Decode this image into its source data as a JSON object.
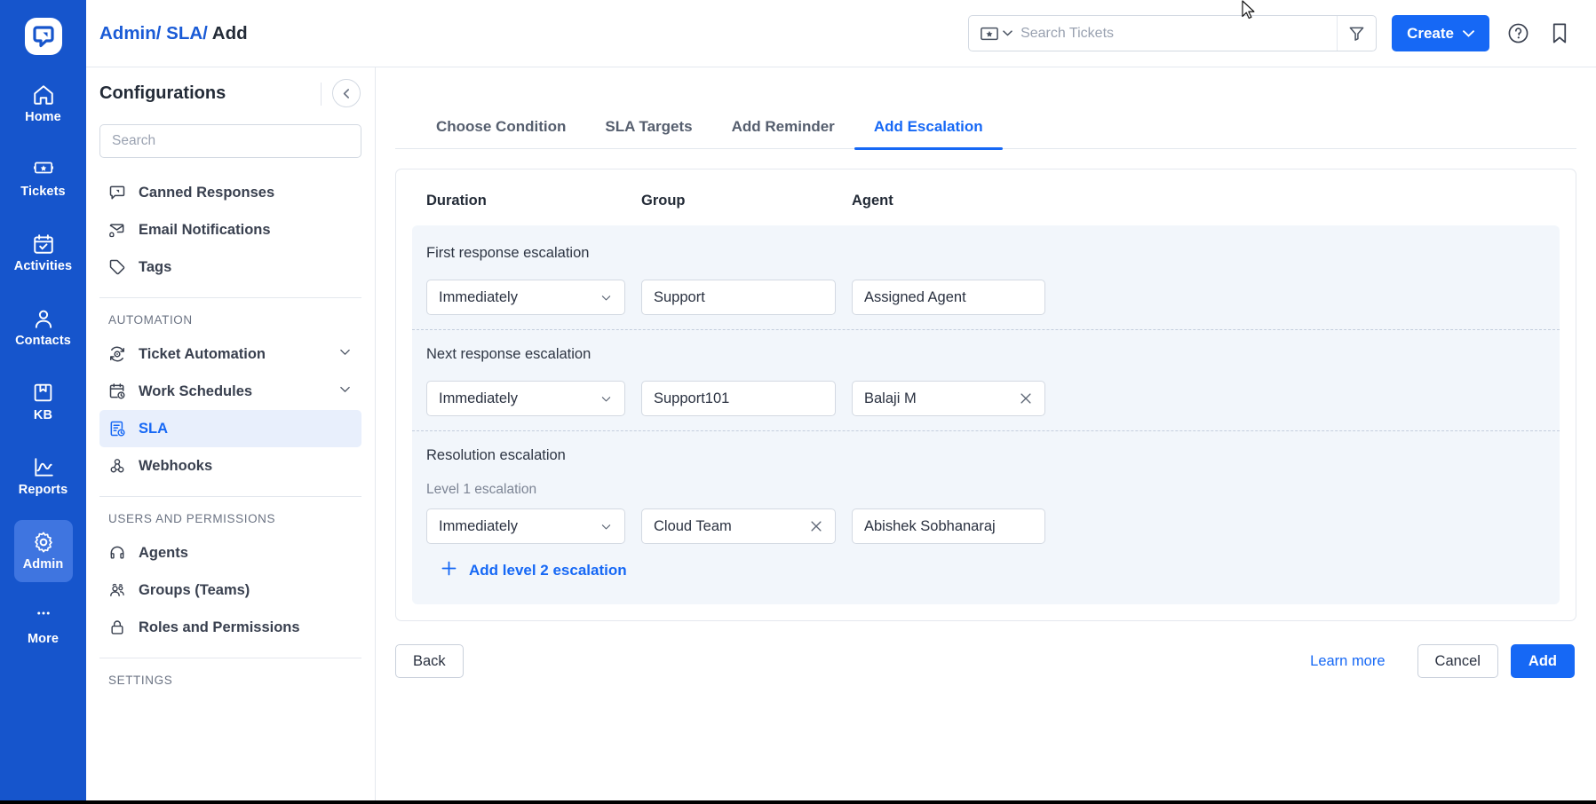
{
  "rail": {
    "logo_icon": "app-logo-icon",
    "items": [
      {
        "label": "Home",
        "icon": "home-icon",
        "active": false
      },
      {
        "label": "Tickets",
        "icon": "ticket-icon",
        "active": false
      },
      {
        "label": "Activities",
        "icon": "calendar-check-icon",
        "active": false
      },
      {
        "label": "Contacts",
        "icon": "person-icon",
        "active": false
      },
      {
        "label": "KB",
        "icon": "book-icon",
        "active": false
      },
      {
        "label": "Reports",
        "icon": "chart-line-icon",
        "active": false
      },
      {
        "label": "Admin",
        "icon": "gear-icon",
        "active": true
      },
      {
        "label": "More",
        "icon": "ellipsis-icon",
        "active": false
      }
    ]
  },
  "topbar": {
    "breadcrumb": [
      {
        "text": "Admin/",
        "link": true
      },
      {
        "text": " SLA/",
        "link": true
      },
      {
        "text": " Add",
        "link": false
      }
    ],
    "search": {
      "placeholder": "Search Tickets",
      "value": "",
      "type_icon": "ticket-icon"
    },
    "filter_icon": "filter-icon",
    "create_label": "Create",
    "help_icon": "help-circle-icon",
    "bookmark_icon": "bookmark-icon"
  },
  "sidebar": {
    "title": "Configurations",
    "collapse_icon": "chevron-left-icon",
    "search_placeholder": "Search",
    "search_value": "",
    "items": [
      {
        "label": "Canned Responses",
        "icon": "canned-response-icon",
        "active": false,
        "chevron": false
      },
      {
        "label": "Email Notifications",
        "icon": "email-bell-icon",
        "active": false,
        "chevron": false
      },
      {
        "label": "Tags",
        "icon": "tag-icon",
        "active": false,
        "chevron": false
      }
    ],
    "group_automation_label": "Automation",
    "automation_items": [
      {
        "label": "Ticket Automation",
        "icon": "automation-icon",
        "active": false,
        "chevron": true
      },
      {
        "label": "Work Schedules",
        "icon": "calendar-clock-icon",
        "active": false,
        "chevron": true
      },
      {
        "label": "SLA",
        "icon": "sla-icon",
        "active": true,
        "chevron": false
      },
      {
        "label": "Webhooks",
        "icon": "webhook-icon",
        "active": false,
        "chevron": false
      }
    ],
    "group_users_label": "Users and Permissions",
    "users_items": [
      {
        "label": "Agents",
        "icon": "headset-icon",
        "active": false,
        "chevron": false
      },
      {
        "label": "Groups (Teams)",
        "icon": "people-icon",
        "active": false,
        "chevron": false
      },
      {
        "label": "Roles and Permissions",
        "icon": "lock-icon",
        "active": false,
        "chevron": false
      }
    ],
    "group_settings_label": "Settings"
  },
  "main": {
    "tabs": [
      {
        "label": "Choose Condition",
        "active": false
      },
      {
        "label": "SLA Targets",
        "active": false
      },
      {
        "label": "Add Reminder",
        "active": false
      },
      {
        "label": "Add Escalation",
        "active": true
      }
    ],
    "columns": [
      "Duration",
      "Group",
      "Agent"
    ],
    "escalations": [
      {
        "title": "First response escalation",
        "sublabel": "",
        "duration": "Immediately",
        "group": "Support",
        "group_clearable": false,
        "agent": "Assigned Agent",
        "agent_clearable": false
      },
      {
        "title": "Next response escalation",
        "sublabel": "",
        "duration": "Immediately",
        "group": "Support101",
        "group_clearable": false,
        "agent": "Balaji M",
        "agent_clearable": true
      },
      {
        "title": "Resolution escalation",
        "sublabel": "Level 1 escalation",
        "duration": "Immediately",
        "group": "Cloud Team",
        "group_clearable": true,
        "agent": "Abishek Sobhanaraj",
        "agent_clearable": false
      }
    ],
    "add_level_label": "Add level 2 escalation",
    "add_level_icon": "plus-icon",
    "footer": {
      "back_label": "Back",
      "learn_more_label": "Learn more",
      "cancel_label": "Cancel",
      "add_label": "Add"
    }
  },
  "colors": {
    "rail_blue": "#1655cc",
    "accent_blue": "#1668f5",
    "link_blue": "#1a5bd6",
    "panel_bg": "#f2f6fb",
    "border": "#e4e8ee"
  }
}
